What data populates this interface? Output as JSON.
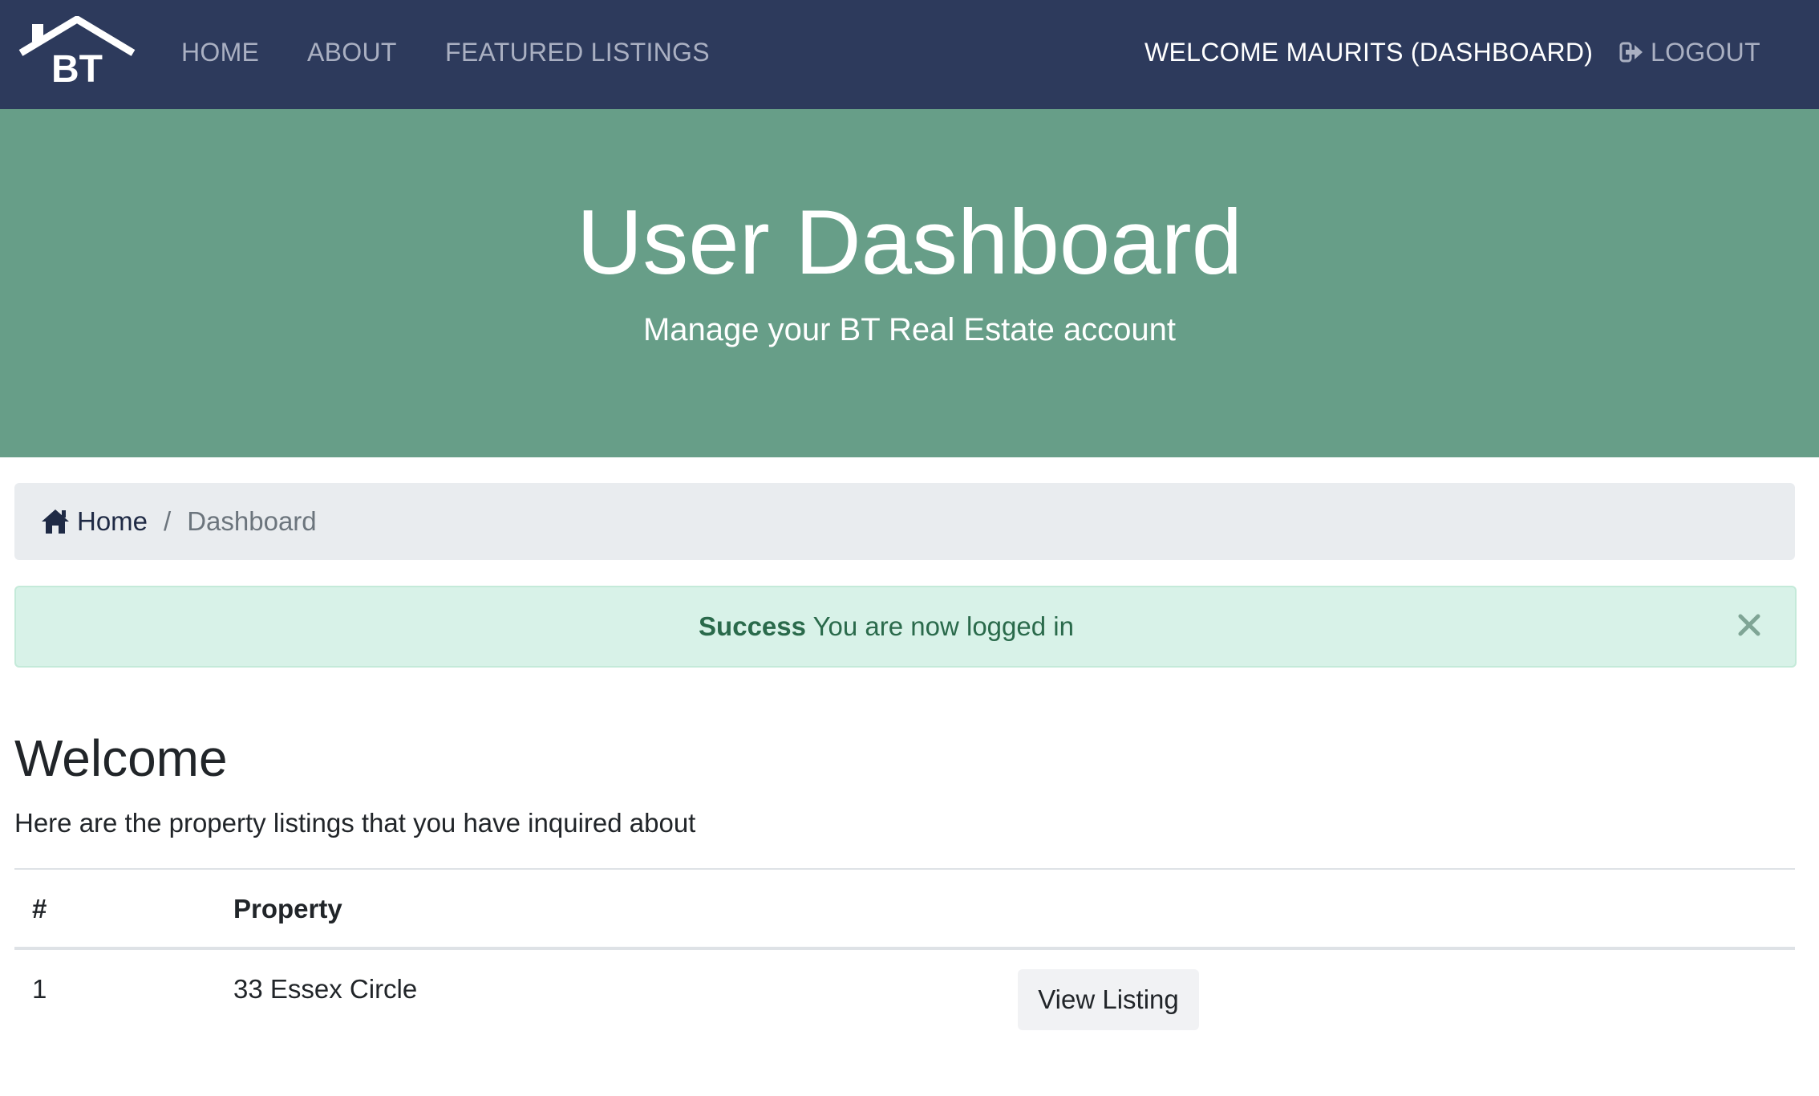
{
  "nav": {
    "logo_text": "BT",
    "home": "HOME",
    "about": "ABOUT",
    "featured": "FEATURED LISTINGS",
    "welcome": "WELCOME MAURITS (DASHBOARD)",
    "logout": "LOGOUT"
  },
  "hero": {
    "title": "User Dashboard",
    "subtitle": "Manage your BT Real Estate account"
  },
  "breadcrumb": {
    "home": "Home",
    "separator": "/",
    "current": "Dashboard"
  },
  "alert": {
    "strong": "Success",
    "message": "You are now logged in",
    "close_icon": "close-icon"
  },
  "welcome": {
    "title": "Welcome",
    "text": "Here are the property listings that you have inquired about"
  },
  "table": {
    "headers": [
      "#",
      "Property",
      ""
    ],
    "rows": [
      {
        "num": "1",
        "property": "33 Essex Circle",
        "action": "View Listing"
      }
    ]
  },
  "colors": {
    "navbar": "#2d3a5c",
    "hero": "#679e88",
    "alert_bg": "#d8f2e8",
    "alert_text": "#2a6a4b"
  },
  "icons": {
    "logout": "sign-out-icon",
    "home": "home-icon"
  }
}
